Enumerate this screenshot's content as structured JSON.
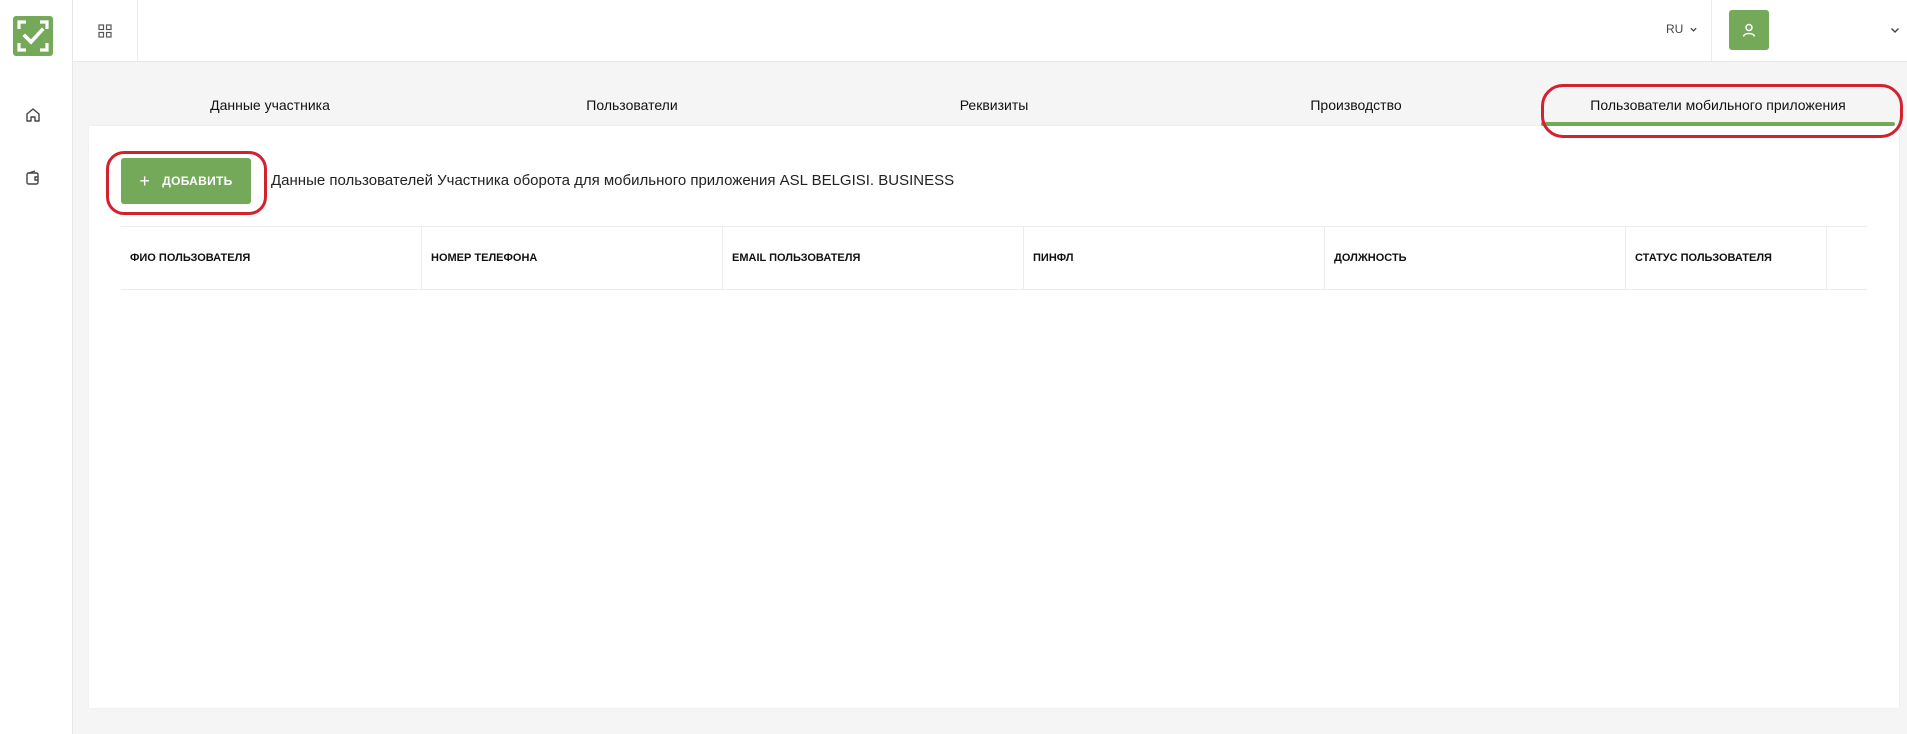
{
  "header": {
    "language": "RU"
  },
  "tabs": [
    {
      "label": "Данные участника",
      "active": false
    },
    {
      "label": "Пользователи",
      "active": false
    },
    {
      "label": "Реквизиты",
      "active": false
    },
    {
      "label": "Производство",
      "active": false
    },
    {
      "label": "Пользователи мобильного приложения",
      "active": true
    }
  ],
  "panel": {
    "add_button_label": "ДОБАВИТЬ",
    "add_button_icon": "+",
    "description": "Данные пользователей Участника оборота для мобильного приложения ASL BELGISI. BUSINESS"
  },
  "table": {
    "columns": [
      "ФИО ПОЛЬЗОВАТЕЛЯ",
      "НОМЕР ТЕЛЕФОНА",
      "EMAIL ПОЛЬЗОВАТЕЛЯ",
      "ПИНФЛ",
      "ДОЛЖНОСТЬ",
      "СТАТУС ПОЛЬЗОВАТЕЛЯ"
    ]
  },
  "colors": {
    "brand": "#74a95a",
    "highlight": "#d3212d"
  },
  "icons": {
    "logo": "check-frame-icon",
    "home": "home-icon",
    "wallet": "wallet-icon",
    "apps": "grid-icon",
    "user": "user-icon",
    "chevron": "chevron-down-icon"
  }
}
